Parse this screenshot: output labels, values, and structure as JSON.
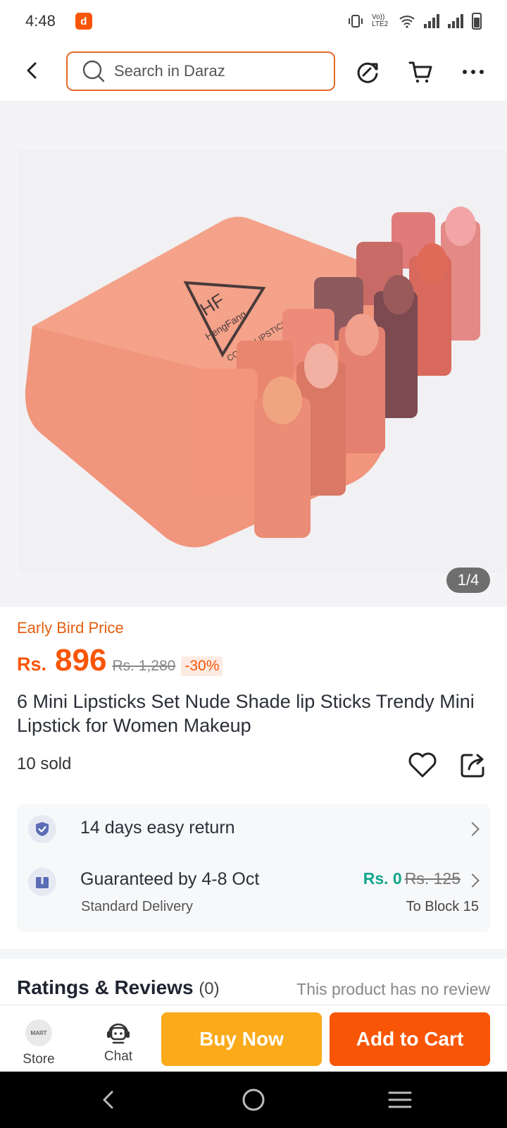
{
  "status_bar": {
    "time": "4:48",
    "network_label": "Vo)) LTE2"
  },
  "header": {
    "search_placeholder": "Search in Daraz"
  },
  "gallery": {
    "page_indicator": "1/4",
    "box_brand_text": "HengFang",
    "box_logo_text": "HF",
    "box_subtitle_text": "COLOR LIPSTICK"
  },
  "product": {
    "promo_label": "Early Bird Price",
    "price_currency": "Rs.",
    "price_value": "896",
    "original_price": "Rs. 1,280",
    "discount": "-30%",
    "title": "6 Mini Lipsticks Set Nude Shade lip Sticks Trendy Mini Lipstick for Women Makeup",
    "sold": "10 sold"
  },
  "services": {
    "return_label": "14 days easy return",
    "delivery_label": "Guaranteed by 4-8 Oct",
    "delivery_type": "Standard Delivery",
    "delivery_fee_now": "Rs. 0",
    "delivery_fee_was": "Rs. 125",
    "delivery_location": "To Block 15"
  },
  "ratings": {
    "title": "Ratings & Reviews",
    "count": "(0)",
    "note": "This product has no review"
  },
  "action_bar": {
    "store_label": "Store",
    "store_avatar_text": "MART",
    "chat_label": "Chat",
    "buy_now": "Buy Now",
    "add_to_cart": "Add to Cart"
  },
  "colors": {
    "brand_orange": "#f85606",
    "buy_now_yellow": "#fbaa1b",
    "free_green": "#12a58d"
  }
}
